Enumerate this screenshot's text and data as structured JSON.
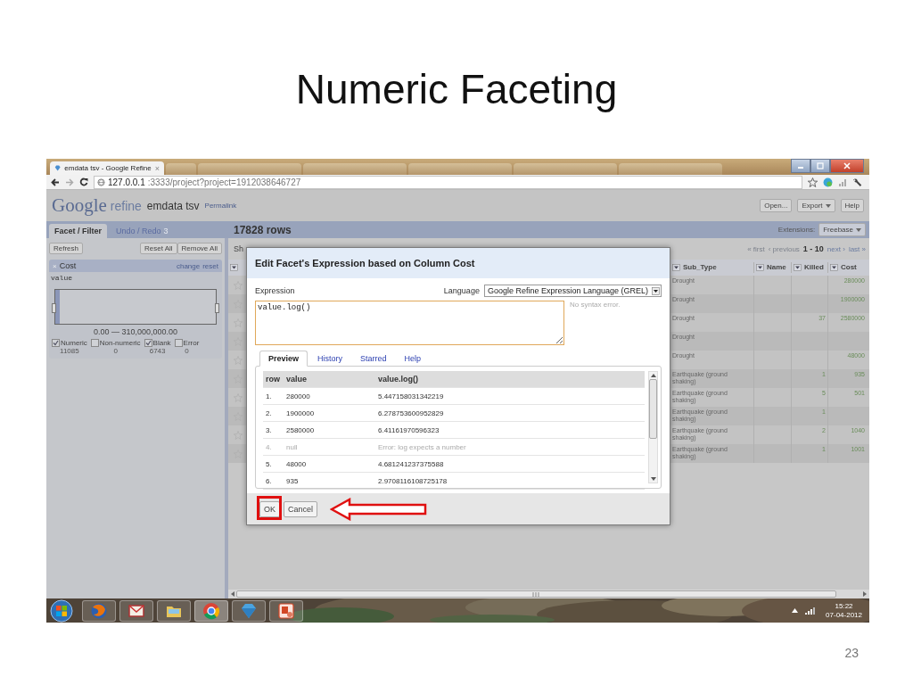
{
  "slide": {
    "title": "Numeric Faceting",
    "page_number": "23"
  },
  "browser": {
    "tabs": [
      {
        "title": "emdata tsv - Google Refine",
        "close": "×",
        "selected": true
      },
      {
        "selected": false
      },
      {
        "selected": false
      },
      {
        "selected": false
      },
      {
        "selected": false
      },
      {
        "selected": false
      },
      {
        "selected": false
      }
    ],
    "url_host": "127.0.0.1",
    "url_path": ":3333/project?project=1912038646727"
  },
  "header": {
    "logo": "Google",
    "product": "refine",
    "project": "emdata tsv",
    "permalink": "Permalink",
    "buttons": [
      {
        "label": "Open...",
        "caret": false
      },
      {
        "label": "Export",
        "caret": true
      },
      {
        "label": "Help",
        "caret": false
      }
    ]
  },
  "left_tabs": [
    {
      "label": "Facet / Filter",
      "selected": true
    },
    {
      "label": "Undo / Redo",
      "badge": "3",
      "selected": false
    }
  ],
  "rows_title": "17828 rows",
  "extensions": {
    "label": "Extensions:",
    "button": {
      "label": "Freebase",
      "caret": true
    }
  },
  "facet_panel": {
    "buttons": [
      "Refresh",
      "Reset All",
      "Remove All"
    ],
    "facet": {
      "close": "×",
      "name": "Cost",
      "links": [
        "change",
        "reset"
      ],
      "expression": "value",
      "range": "0.00 — 310,000,000.00",
      "choices": [
        {
          "label": "Numeric",
          "count": "11085",
          "checked": true
        },
        {
          "label": "Non-numeric",
          "count": "0",
          "checked": false
        },
        {
          "label": "Blank",
          "count": "6743",
          "checked": true
        },
        {
          "label": "Error",
          "count": "0",
          "checked": false
        }
      ]
    }
  },
  "grid": {
    "cut_text": "Sh",
    "pager": [
      {
        "label": "« first",
        "kind": "link",
        "disabled": true
      },
      {
        "label": "‹ previous",
        "kind": "link",
        "disabled": true
      },
      {
        "label": "1 - 10",
        "kind": "range"
      },
      {
        "label": "next ›",
        "kind": "link",
        "disabled": false
      },
      {
        "label": "last »",
        "kind": "link",
        "disabled": false
      }
    ],
    "columns": [
      "Sub_Type",
      "Name",
      "Killed",
      "Cost"
    ],
    "rows": [
      {
        "sub_type": "Drought",
        "cost": "280000"
      },
      {
        "sub_type": "Drought",
        "cost": "1900000"
      },
      {
        "sub_type": "Drought",
        "killed": "37",
        "cost": "2580000"
      },
      {
        "sub_type": "Drought"
      },
      {
        "sub_type": "Drought",
        "cost": "48000"
      },
      {
        "sub_type": "Earthquake (ground shaking)",
        "killed": "1",
        "cost": "935"
      },
      {
        "sub_type": "Earthquake (ground shaking)",
        "killed": "5",
        "cost": "501"
      },
      {
        "sub_type": "Earthquake (ground shaking)",
        "killed": "1"
      },
      {
        "sub_type": "Earthquake (ground shaking)",
        "killed": "2",
        "cost": "1040"
      },
      {
        "sub_type": "Earthquake (ground shaking)",
        "killed": "1",
        "cost": "1001"
      }
    ]
  },
  "dialog": {
    "title": "Edit Facet's Expression based on Column Cost",
    "expression_label": "Expression",
    "language_label": "Language",
    "language": "Google Refine Expression Language (GREL)",
    "expression": "value.log()",
    "status": "No syntax error.",
    "tabs": [
      {
        "label": "Preview",
        "selected": true
      },
      {
        "label": "History",
        "selected": false
      },
      {
        "label": "Starred",
        "selected": false
      },
      {
        "label": "Help",
        "selected": false
      }
    ],
    "preview_columns": [
      "row",
      "value",
      "value.log()"
    ],
    "preview_rows": [
      {
        "row": "1.",
        "value": "280000",
        "result": "5.447158031342219",
        "error": false
      },
      {
        "row": "2.",
        "value": "1900000",
        "result": "6.278753600952829",
        "error": false
      },
      {
        "row": "3.",
        "value": "2580000",
        "result": "6.41161970596323",
        "error": false
      },
      {
        "row": "4.",
        "value": "null",
        "result": "Error: log expects a number",
        "error": true
      },
      {
        "row": "5.",
        "value": "48000",
        "result": "4.681241237375588",
        "error": false
      },
      {
        "row": "6.",
        "value": "935",
        "result": "2.9708116108725178",
        "error": false
      }
    ],
    "buttons": [
      "OK",
      "Cancel"
    ]
  },
  "taskbar": {
    "time": "15:22",
    "date": "07-04-2012"
  }
}
